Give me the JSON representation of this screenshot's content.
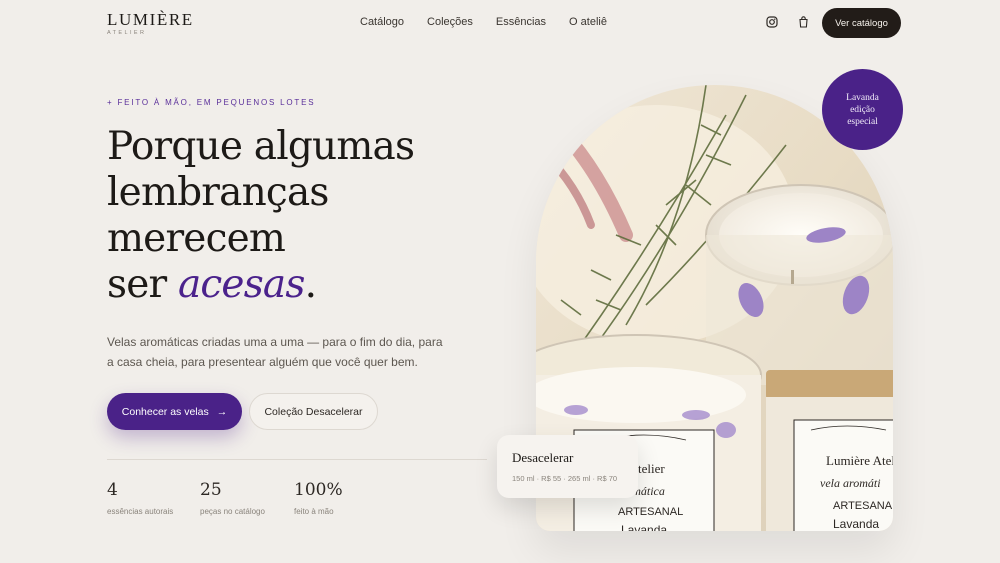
{
  "brand": {
    "name": "LUMIÈRE",
    "sub": "ATELIER"
  },
  "nav": {
    "items": [
      "Catálogo",
      "Coleções",
      "Essências",
      "O ateliê"
    ]
  },
  "header": {
    "instagram_icon": "instagram-icon",
    "bag_icon": "shopping-bag-icon",
    "cta_label": "Ver catálogo"
  },
  "hero": {
    "eyebrow": "+ FEITO À MÃO, EM PEQUENOS LOTES",
    "headline_lines": [
      "Porque algumas",
      "lembranças",
      "merecem"
    ],
    "headline_last_prefix": "ser ",
    "headline_accent": "acesas",
    "headline_suffix": ".",
    "lead": "Velas aromáticas criadas uma a uma — para o fim do dia, para a casa cheia, para presentear alguém que você quer bem.",
    "primary_label": "Conhecer as velas",
    "primary_arrow": "→",
    "secondary_label": "Coleção Desacelerar"
  },
  "stats": [
    {
      "value": "4",
      "label": "essências autorais"
    },
    {
      "value": "25",
      "label": "peças no catálogo"
    },
    {
      "value": "100%",
      "label": "feito à mão"
    }
  ],
  "badge": {
    "line1": "Lavanda",
    "line2": "edição",
    "line3": "especial"
  },
  "product": {
    "name": "Desacelerar",
    "meta": "150 ml · R$ 55  ·  265 ml · R$ 70"
  },
  "photo": {
    "label_brand": "Lumière Atel",
    "label_script": "vela aromáti",
    "label_type": "ARTESANAL",
    "label_scent": "Lavanda",
    "label2_script": "aromática",
    "label2_type": "ARTESANAL",
    "label2_scent": "Lavanda",
    "label2_brand": "re Atelier"
  },
  "colors": {
    "accent": "#4a2288",
    "background": "#f1eeea",
    "dark": "#221c18"
  }
}
